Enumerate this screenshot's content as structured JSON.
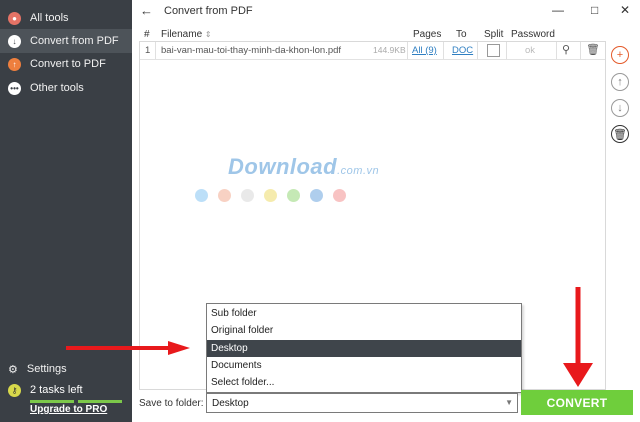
{
  "sidebar": {
    "items": [
      {
        "label": "All tools",
        "icon": "apps-icon"
      },
      {
        "label": "Convert from PDF",
        "icon": "pdf-from-icon"
      },
      {
        "label": "Convert to PDF",
        "icon": "pdf-to-icon"
      },
      {
        "label": "Other tools",
        "icon": "more-icon"
      }
    ],
    "settings": "Settings",
    "tasks_left": "2 tasks left",
    "upgrade": "Upgrade to PRO"
  },
  "window": {
    "title": "Convert from PDF",
    "back": "←",
    "minimize": "—",
    "maximize": "□",
    "close": "✕"
  },
  "table": {
    "headers": {
      "num": "#",
      "filename": "Filename",
      "pages": "Pages",
      "to": "To",
      "split": "Split",
      "password": "Password"
    },
    "rows": [
      {
        "num": "1",
        "filename": "bai-van-mau-toi-thay-minh-da-khon-lon.pdf",
        "size": "144.9KB",
        "pages": "All (9)",
        "to": "DOC",
        "password": "ok"
      }
    ]
  },
  "watermark": {
    "text": "Download",
    "suffix": ".com.vn"
  },
  "dropdown": {
    "options": [
      "Sub folder",
      "Original folder",
      "Desktop",
      "Documents",
      "Select folder..."
    ],
    "selected_index": 2
  },
  "save": {
    "label": "Save to folder:",
    "value": "Desktop"
  },
  "convert_button": "CONVERT",
  "colors": {
    "accent": "#6fce3c",
    "sidebar": "#3a3f45",
    "arrow": "#e8191c",
    "link": "#2f7fc2"
  }
}
